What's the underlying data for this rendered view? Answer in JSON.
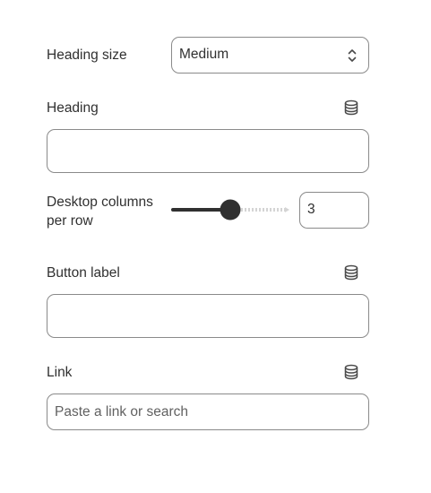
{
  "heading_size": {
    "label": "Heading size",
    "selected": "Medium"
  },
  "heading": {
    "label": "Heading",
    "value": ""
  },
  "desktop_columns": {
    "label_line1": "Desktop columns",
    "label_line2": "per row",
    "value": "3",
    "slider_fraction": 0.5
  },
  "button_label": {
    "label": "Button label",
    "value": ""
  },
  "link": {
    "label": "Link",
    "placeholder": "Paste a link or search"
  },
  "icons": {
    "dynamic_source": "database-icon",
    "select_chevrons": "chevron-up-down-icon"
  },
  "colors": {
    "text": "#303030",
    "border": "#8a8a8a",
    "slider_fill": "#303030",
    "slider_track": "#d4d4d4"
  }
}
